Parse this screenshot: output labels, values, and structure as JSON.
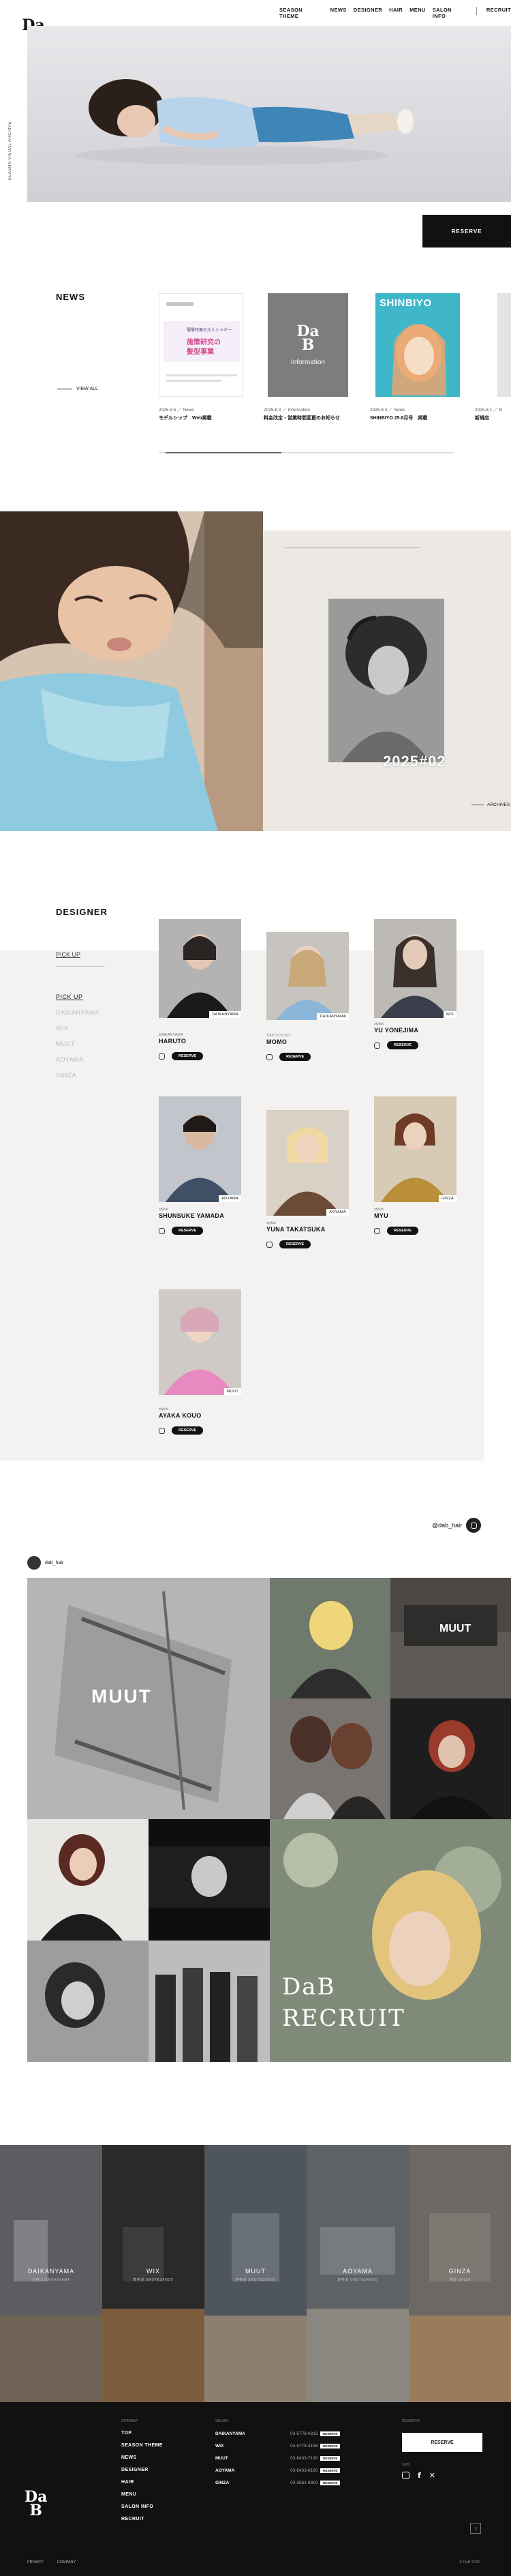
{
  "brand": {
    "logo_top": "Da",
    "logo_bottom": "B"
  },
  "nav": {
    "items": [
      "SEASON THEME",
      "NEWS",
      "DESIGNER",
      "HAIR",
      "MENU",
      "SALON INFO"
    ],
    "recruit": "RECRUIT"
  },
  "hero": {
    "vertical_text": "SEASON VISUAL ARCHIVE"
  },
  "reserve_label": "RESERVE",
  "news": {
    "title": "NEWS",
    "view_all": "VIEW ALL",
    "items": [
      {
        "meta": "2025.9.5 ／ News",
        "title": "モデルシップ　Web掲載",
        "thumb_line1": "電撃特集の大人シャギー",
        "thumb_line2": "施策研究の",
        "thumb_line3": "髪型事業"
      },
      {
        "meta": "2025.8.3 ／ Information",
        "title": "料金改定・営業時間変更のお知らせ",
        "thumb_logo_top": "Da",
        "thumb_logo_bottom": "B",
        "thumb_text": "Information"
      },
      {
        "meta": "2025.8.3 ／ News",
        "title": "SHINBIYO 25.8月号　掲載",
        "thumb_text": "SHINBIYO"
      },
      {
        "meta": "2025.8.1 ／ N",
        "title": "新規店"
      }
    ]
  },
  "season": {
    "number": "2025#02",
    "archive": "ARCHIVES"
  },
  "designer": {
    "title": "DESIGNER",
    "pickup_heading": "PICK UP",
    "tabs": [
      "PICK UP",
      "DAIKANYAMA",
      "WIX",
      "MUUT",
      "AOYAMA",
      "GINZA"
    ],
    "reserve": "RESERVE",
    "cards": [
      {
        "role": "DAIKANYAMA",
        "name": "HARUTO",
        "tag": "DAIKANYAMA"
      },
      {
        "role": "TOP STYLIST",
        "name": "MOMO",
        "tag": "DAIKANYAMA"
      },
      {
        "role": "stylist",
        "name": "YU YONEJIMA",
        "tag": "WIX"
      },
      {
        "role": "stylist",
        "name": "SHUNSUKE YAMADA",
        "tag": "AOYAMA"
      },
      {
        "role": "stylist",
        "name": "YUNA TAKATSUKA",
        "tag": "AOYAMA"
      },
      {
        "role": "stylist",
        "name": "MYU",
        "tag": "GINZA"
      },
      {
        "role": "stylist",
        "name": "AYAKA KOUO",
        "tag": "MUUT"
      }
    ]
  },
  "instagram": {
    "handle": "@dab_hair",
    "user": "dab_hair",
    "tiles": [
      {
        "caption": "MUUT"
      },
      {
        "caption": "MUUT"
      },
      {
        "caption_top": "DaB",
        "caption_bottom": "RECRUIT"
      }
    ]
  },
  "salons": [
    {
      "name": "DAIKANYAMA",
      "sub": "代官山 DAIKANYAMA"
    },
    {
      "name": "WIX",
      "sub": "表参道 OMOTESANDO"
    },
    {
      "name": "MUUT",
      "sub": "表参道 OMOTESANDO"
    },
    {
      "name": "AOYAMA",
      "sub": "表参道 OMOTESANDO"
    },
    {
      "name": "GINZA",
      "sub": "銀座 GINZA"
    }
  ],
  "footer": {
    "sitemap_heading": "SITEMAP",
    "salon_heading": "SALON",
    "reserve_heading": "RESERVE",
    "sns_heading": "SNS",
    "menu": [
      "TOP",
      "SEASON THEME",
      "NEWS",
      "DESIGNER",
      "HAIR",
      "MENU",
      "SALON INFO",
      "RECRUIT"
    ],
    "salon_rows": [
      {
        "name": "DAIKANYAMA",
        "tel": "03-5778-0218"
      },
      {
        "name": "WIX",
        "tel": "03-5778-4198"
      },
      {
        "name": "MUUT",
        "tel": "03-6433-7130"
      },
      {
        "name": "AOYAMA",
        "tel": "03-6433-8180"
      },
      {
        "name": "GINZA",
        "tel": "03-3561-8800"
      }
    ],
    "reserve_btn": "RESERVE",
    "res_small": "RESERVE",
    "privacy": "PRIVACY",
    "company": "COMPANY",
    "copyright": "© DaB 2025"
  },
  "colors": {
    "dark": "#111111",
    "beige": "#ece9e5",
    "grey_bg": "#f3f2f0",
    "aqua": "#8fcbe0"
  }
}
